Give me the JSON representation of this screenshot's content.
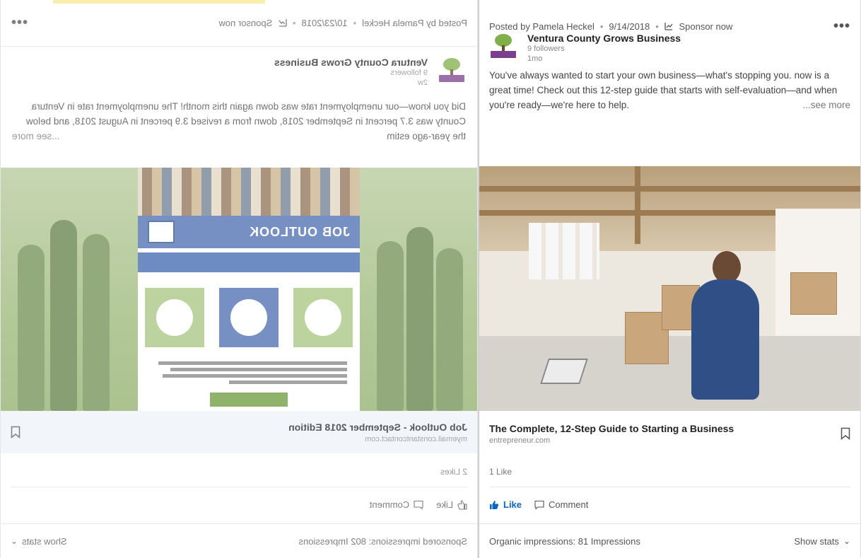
{
  "left_post": {
    "header": {
      "posted_by": "Posted by Pamela Heckel",
      "date": "10/23/2018",
      "sponsor": "Sponsor now",
      "more": "•••"
    },
    "company": {
      "name": "Ventura County Grows Business",
      "followers": "9 followers",
      "age": "2w"
    },
    "text": "Did you know—our unemployment rate was down again this month! The unemployment rate in Ventura County was 3.7 percent in September 2018, down from a revised 3.9 percent in August 2018, and below the year-ago estim",
    "see_more": "...see more",
    "flyer": {
      "title": "JOB OUTLOOK"
    },
    "link": {
      "title": "Job Outlook - September 2018 Edition",
      "url": "myemail.constantcontact.com"
    },
    "likes": "2 Likes",
    "actions": {
      "like": "Like",
      "comment": "Comment"
    },
    "footer": {
      "impressions": "Sponsored impressions: 802 Impressions",
      "show_stats": "Show stats"
    }
  },
  "right_post": {
    "header": {
      "posted_by": "Posted by Pamela Heckel",
      "date": "9/14/2018",
      "sponsor": "Sponsor now",
      "more": "•••"
    },
    "company": {
      "name": "Ventura County Grows Business",
      "followers": "9 followers",
      "age": "1mo"
    },
    "text": "You've always wanted to start your own business—what's stopping you. now is a great time! Check out this 12-step guide that starts with self-evaluation—and when you're ready—we're here to help.",
    "see_more": "...see more",
    "link": {
      "title": "The Complete, 12-Step Guide to Starting a Business",
      "url": "entrepreneur.com"
    },
    "likes": "1 Like",
    "actions": {
      "like": "Like",
      "comment": "Comment"
    },
    "footer": {
      "impressions": "Organic impressions: 81 Impressions",
      "show_stats": "Show stats"
    }
  },
  "colors": {
    "like_active": "#0a66c2",
    "logo_green": "#7fae4a",
    "logo_purple": "#7a3f8d",
    "flyer_blue": "#4a6bb0"
  },
  "icons": [
    "more-icon",
    "sponsor-chart-icon",
    "bookmark-icon",
    "thumbs-up-icon",
    "comment-icon",
    "chevron-down-icon"
  ]
}
